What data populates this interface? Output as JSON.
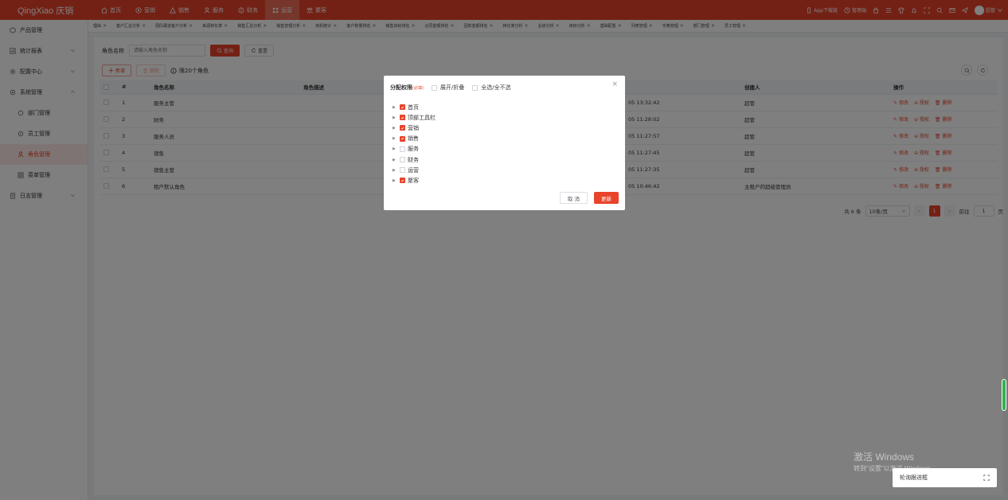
{
  "brand": {
    "logo": "QingXiao 庆销",
    "accent": "#e8432b"
  },
  "topnav": [
    {
      "label": "首页",
      "icon": "home-icon",
      "active": false
    },
    {
      "label": "营销",
      "icon": "target-icon",
      "active": false
    },
    {
      "label": "销售",
      "icon": "chart-icon",
      "active": false
    },
    {
      "label": "服务",
      "icon": "person-icon",
      "active": false
    },
    {
      "label": "财务",
      "icon": "coin-icon",
      "active": false
    },
    {
      "label": "运营",
      "icon": "grid-icon",
      "active": true
    },
    {
      "label": "聚客",
      "icon": "people-icon",
      "active": false
    }
  ],
  "topright": {
    "app": "App下载链",
    "admin": "管理端",
    "user": "超管"
  },
  "sidebar": [
    {
      "label": "产品管理",
      "icon": "box-icon"
    },
    {
      "label": "统计报表",
      "icon": "report-icon"
    },
    {
      "label": "配置中心",
      "icon": "gear-icon"
    },
    {
      "label": "系统管理",
      "icon": "settings-icon"
    },
    {
      "label": "部门管理",
      "icon": "dept-icon"
    },
    {
      "label": "员工管理",
      "icon": "staff-icon"
    },
    {
      "label": "角色管理",
      "icon": "role-icon"
    },
    {
      "label": "菜单管理",
      "icon": "menu-icon"
    },
    {
      "label": "日志管理",
      "icon": "log-icon"
    }
  ],
  "tabs": [
    "理由",
    "客户汇总分析",
    "团队跟进客户分析",
    "来源转化率",
    "销售汇总分析",
    "销售管理分析",
    "商机统计",
    "客户数量排名",
    "销售目标排名",
    "合同金额排名",
    "回款金额排名",
    "转化率分析",
    "业绩分析",
    "目标分析",
    "基础配置",
    "列表管理",
    "字典管理",
    "部门管理",
    "员工管理"
  ],
  "search": {
    "label": "角色名称",
    "placeholder": "请输入角色名称",
    "query": "查询",
    "reset": "重置"
  },
  "toolbar": {
    "add": "新增",
    "delete": "删除",
    "note": "限20个角色"
  },
  "table": {
    "headers": [
      "#",
      "角色名称",
      "角色描述",
      "创建人",
      "操作"
    ],
    "rows": [
      {
        "no": "1",
        "name": "服务主管",
        "desc": "",
        "time": "05 13:32:42",
        "creator": "超管"
      },
      {
        "no": "2",
        "name": "财务",
        "desc": "",
        "time": "05 11:28:02",
        "creator": "超管"
      },
      {
        "no": "3",
        "name": "服务人员",
        "desc": "",
        "time": "05 11:27:57",
        "creator": "超管"
      },
      {
        "no": "4",
        "name": "销售",
        "desc": "",
        "time": "05 11:27:45",
        "creator": "超管"
      },
      {
        "no": "5",
        "name": "销售主管",
        "desc": "",
        "time": "05 11:27:35",
        "creator": "超管"
      },
      {
        "no": "6",
        "name": "租户默认角色",
        "desc": "",
        "time": "05 10:46:42",
        "creator": "主租户的超级管理员"
      }
    ],
    "ops": {
      "edit": "修改",
      "auth": "授权",
      "delete": "删除"
    }
  },
  "pager": {
    "total": "共 6 条",
    "size": "10条/页",
    "current": "1",
    "goto": "前往",
    "page_input": "1",
    "unit": "页"
  },
  "modal": {
    "title": "分配权限",
    "required": "(必填)",
    "expand": "展开/折叠",
    "select_all": "全选/全不选",
    "tree": [
      {
        "label": "首页",
        "checked": true
      },
      {
        "label": "顶部工具栏",
        "checked": true
      },
      {
        "label": "营销",
        "checked": true
      },
      {
        "label": "销售",
        "checked": true
      },
      {
        "label": "服务",
        "checked": false
      },
      {
        "label": "财务",
        "checked": false
      },
      {
        "label": "运营",
        "checked": false
      },
      {
        "label": "聚客",
        "checked": true
      }
    ],
    "cancel": "取 消",
    "confirm": "更新"
  },
  "watermark": {
    "line1": "激活 Windows",
    "line2": "转到\"设置\"以激活 Windows。"
  },
  "floatbox": {
    "label": "轮询跟进框"
  }
}
